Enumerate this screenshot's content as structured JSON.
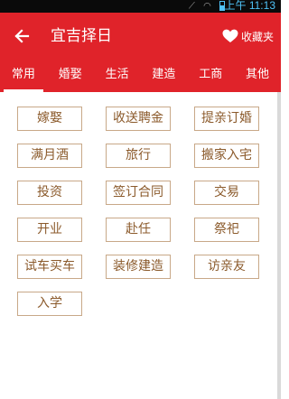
{
  "status_bar": {
    "time": "上午 11:13"
  },
  "app_bar": {
    "title": "宜吉择日",
    "favorites_label": "收藏夹"
  },
  "tabs": [
    {
      "label": "常用",
      "active": true
    },
    {
      "label": "婚娶",
      "active": false
    },
    {
      "label": "生活",
      "active": false
    },
    {
      "label": "建造",
      "active": false
    },
    {
      "label": "工商",
      "active": false
    },
    {
      "label": "其他",
      "active": false
    }
  ],
  "events": [
    "嫁娶",
    "收送聘金",
    "提亲订婚",
    "满月酒",
    "旅行",
    "搬家入宅",
    "投资",
    "签订合同",
    "交易",
    "开业",
    "赴任",
    "祭祀",
    "试车买车",
    "装修建造",
    "访亲友",
    "入学"
  ],
  "colors": {
    "primary": "#e0232a",
    "item_text": "#8b5a2b",
    "item_border": "#c8a888"
  }
}
